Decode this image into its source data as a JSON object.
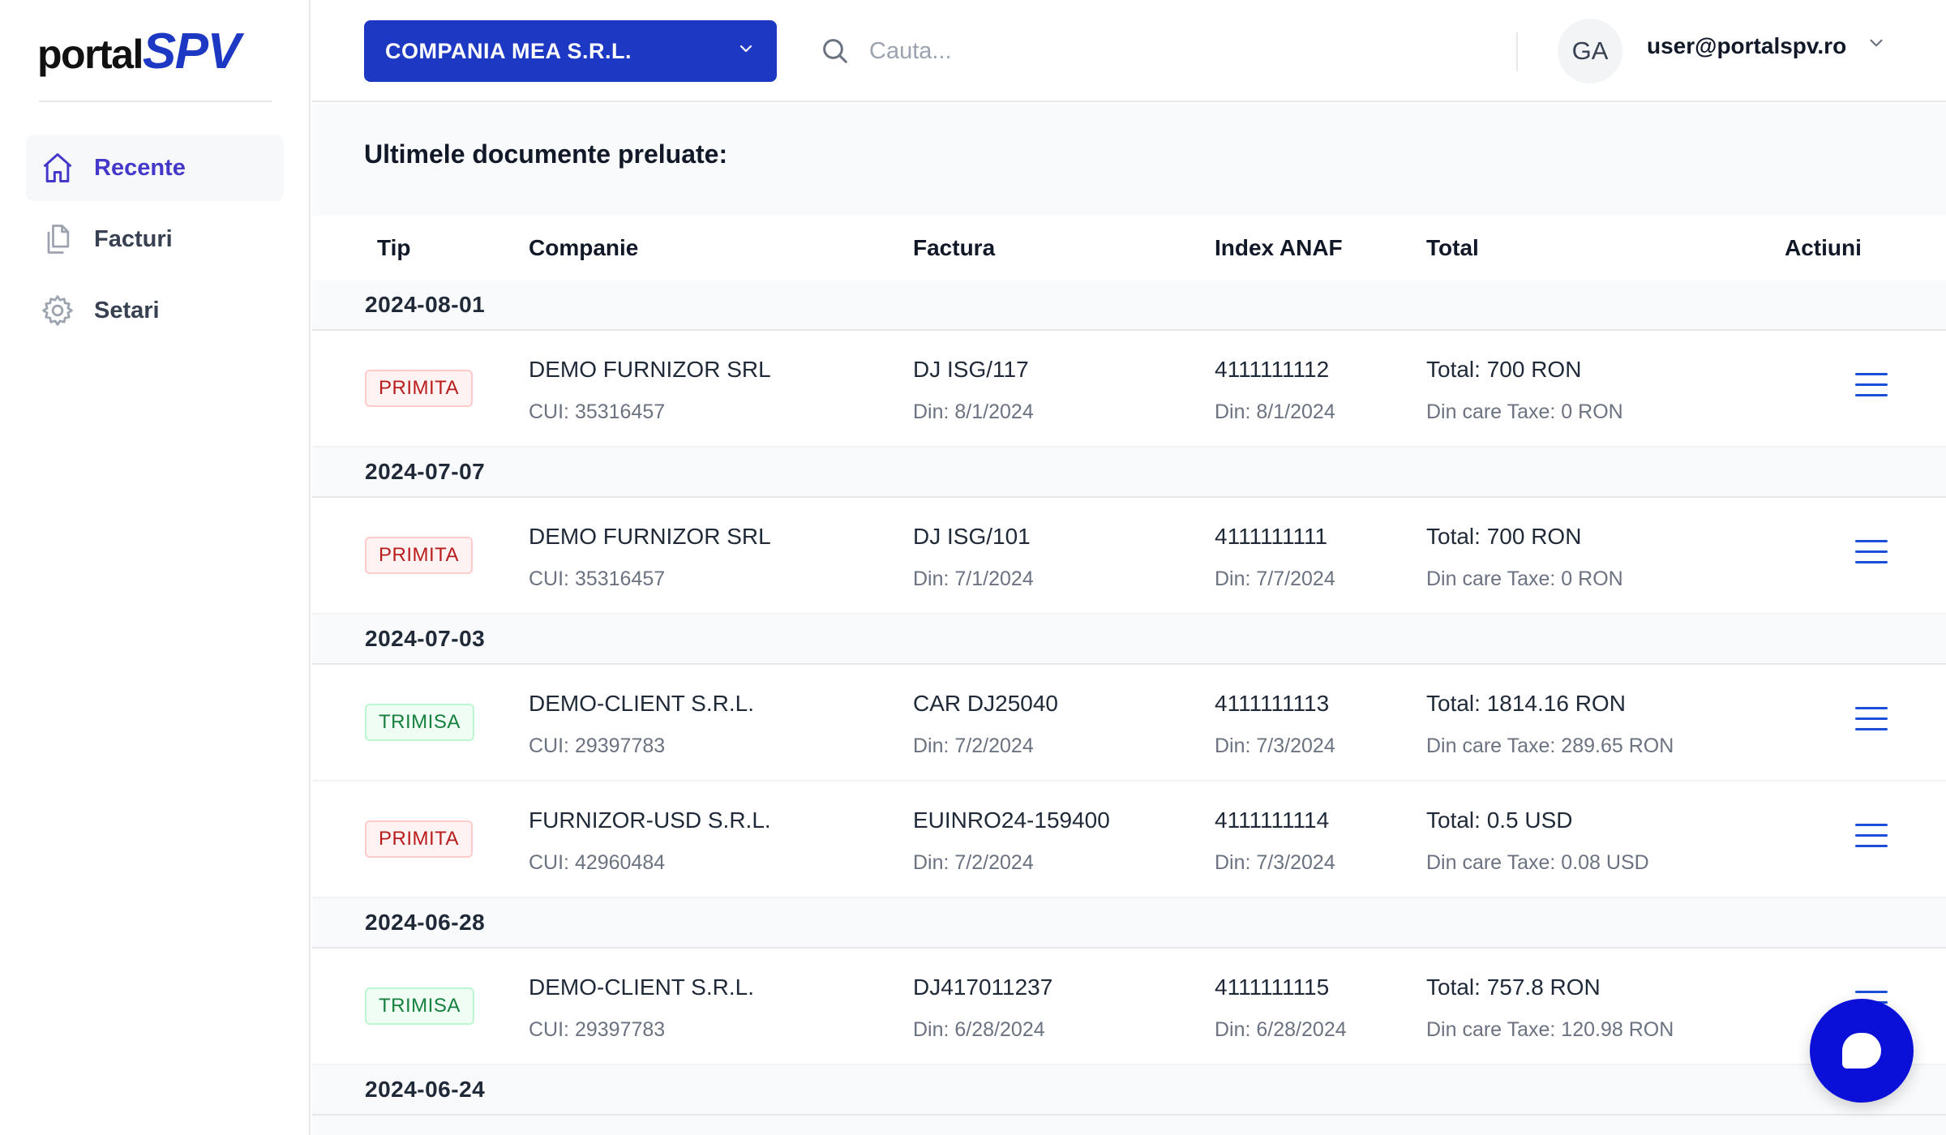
{
  "logo": {
    "part1": "portal",
    "part2": "SPV"
  },
  "sidebar": {
    "items": [
      {
        "label": "Recente",
        "icon": "home-icon",
        "active": true
      },
      {
        "label": "Facturi",
        "icon": "documents-icon",
        "active": false
      },
      {
        "label": "Setari",
        "icon": "gear-icon",
        "active": false
      }
    ]
  },
  "topbar": {
    "company": "COMPANIA MEA S.R.L.",
    "search_placeholder": "Cauta...",
    "avatar_initials": "GA",
    "user_email": "user@portalspv.ro"
  },
  "main": {
    "title": "Ultimele documente preluate:",
    "columns": [
      "Tip",
      "Companie",
      "Factura",
      "Index ANAF",
      "Total",
      "Actiuni"
    ],
    "groups": [
      {
        "date": "2024-08-01",
        "rows": [
          {
            "type": "PRIMITA",
            "type_color": "red",
            "company": "DEMO FURNIZOR SRL",
            "cui": "CUI: 35316457",
            "invoice": "DJ ISG/117",
            "invoice_date": "Din: 8/1/2024",
            "index": "4111111112",
            "index_date": "Din: 8/1/2024",
            "total": "Total: 700 RON",
            "taxes": "Din care Taxe: 0 RON"
          }
        ]
      },
      {
        "date": "2024-07-07",
        "rows": [
          {
            "type": "PRIMITA",
            "type_color": "red",
            "company": "DEMO FURNIZOR SRL",
            "cui": "CUI: 35316457",
            "invoice": "DJ ISG/101",
            "invoice_date": "Din: 7/1/2024",
            "index": "4111111111",
            "index_date": "Din: 7/7/2024",
            "total": "Total: 700 RON",
            "taxes": "Din care Taxe: 0 RON"
          }
        ]
      },
      {
        "date": "2024-07-03",
        "rows": [
          {
            "type": "TRIMISA",
            "type_color": "green",
            "company": "DEMO-CLIENT S.R.L.",
            "cui": "CUI: 29397783",
            "invoice": "CAR DJ25040",
            "invoice_date": "Din: 7/2/2024",
            "index": "4111111113",
            "index_date": "Din: 7/3/2024",
            "total": "Total: 1814.16 RON",
            "taxes": "Din care Taxe: 289.65 RON"
          },
          {
            "type": "PRIMITA",
            "type_color": "red",
            "company": "FURNIZOR-USD S.R.L.",
            "cui": "CUI: 42960484",
            "invoice": "EUINRO24-159400",
            "invoice_date": "Din: 7/2/2024",
            "index": "4111111114",
            "index_date": "Din: 7/3/2024",
            "total": "Total: 0.5 USD",
            "taxes": "Din care Taxe: 0.08 USD"
          }
        ]
      },
      {
        "date": "2024-06-28",
        "rows": [
          {
            "type": "TRIMISA",
            "type_color": "green",
            "company": "DEMO-CLIENT S.R.L.",
            "cui": "CUI: 29397783",
            "invoice": "DJ417011237",
            "invoice_date": "Din: 6/28/2024",
            "index": "4111111115",
            "index_date": "Din: 6/28/2024",
            "total": "Total: 757.8 RON",
            "taxes": "Din care Taxe: 120.98 RON"
          }
        ]
      },
      {
        "date": "2024-06-24",
        "rows": []
      }
    ]
  },
  "colors": {
    "brand": "#1d39c4",
    "accent_nav": "#4338ca",
    "chat": "#0b10d8"
  }
}
